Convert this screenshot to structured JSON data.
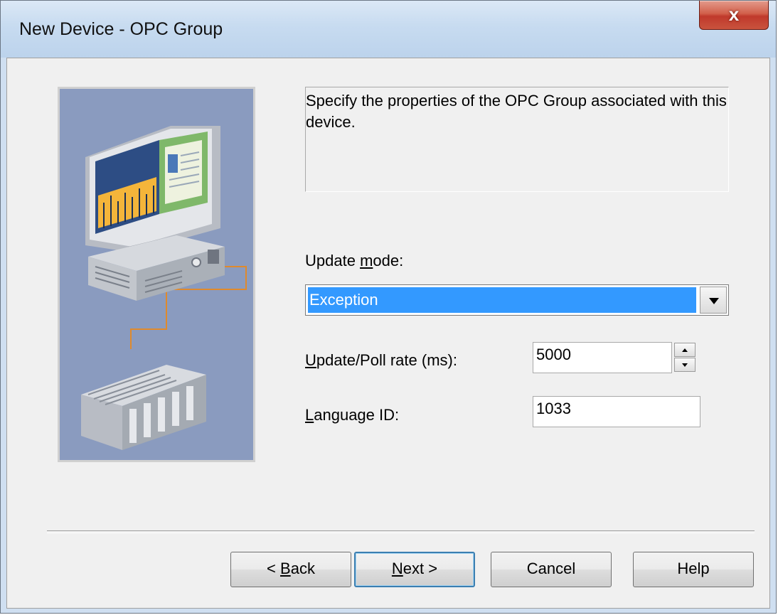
{
  "window": {
    "title": "New Device - OPC Group",
    "close_label": "x"
  },
  "description": "Specify the properties of the OPC Group associated with this device.",
  "update_mode": {
    "label_pre": "Update ",
    "label_accel": "m",
    "label_post": "ode:",
    "selected": "Exception"
  },
  "update_rate": {
    "label_accel": "U",
    "label_post": "pdate/Poll rate (ms):",
    "value": "5000"
  },
  "language": {
    "label_accel": "L",
    "label_post": "anguage ID:",
    "value": "1033"
  },
  "buttons": {
    "back_pre": "< ",
    "back_accel": "B",
    "back_post": "ack",
    "next_accel": "N",
    "next_post": "ext >",
    "cancel": "Cancel",
    "help": "Help"
  },
  "icons": {
    "close": "close-icon",
    "dropdown": "chevron-down-icon",
    "spin_up": "spin-up-icon",
    "spin_down": "spin-down-icon",
    "illustration": "computer-plc-illustration"
  },
  "colors": {
    "selection": "#3399ff",
    "close_button": "#c9533d",
    "illustration_background": "#8a9bbf"
  }
}
